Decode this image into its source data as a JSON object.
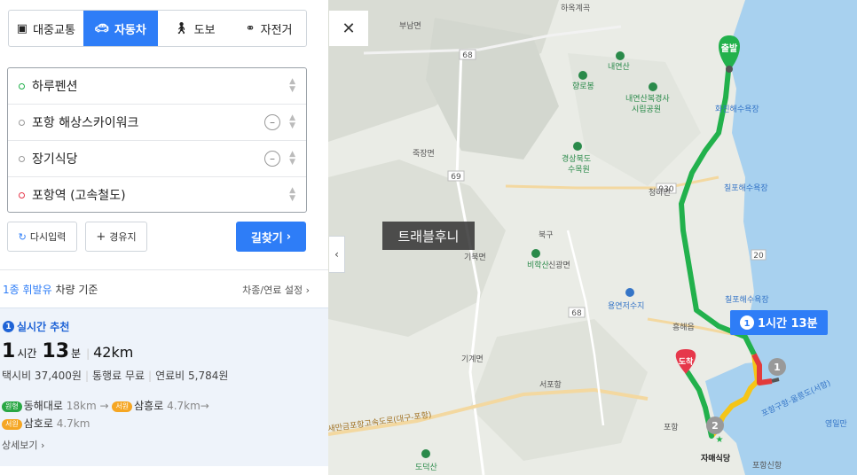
{
  "tabs": [
    {
      "label": "대중교통",
      "icon": "bus-icon"
    },
    {
      "label": "자동차",
      "icon": "car-icon"
    },
    {
      "label": "도보",
      "icon": "walk-icon"
    },
    {
      "label": "자전거",
      "icon": "bike-icon"
    }
  ],
  "waypoints": [
    "하루펜션",
    "포항 해상스카이워크",
    "장기식당",
    "포항역 (고속철도)"
  ],
  "buttons": {
    "reset": "다시입력",
    "add_via": "경유지",
    "find": "길찾기"
  },
  "fuel": {
    "highlight": "1종 휘발유",
    "rest": " 차량 기준",
    "settings": "차종/연료 설정"
  },
  "result": {
    "badge_num": "1",
    "rec_label": "실시간 추천",
    "hour": "1",
    "hour_unit": "시간",
    "minute": "13",
    "minute_unit": "분",
    "distance": "42km",
    "taxi": "택시비 37,400원",
    "toll": "통행료 무료",
    "fuel_cost": "연료비 5,784원",
    "road1_badge": "원형",
    "road1": "동해대로",
    "road1_km": "18km",
    "road2_badge": "서원",
    "road2": "삼흥로",
    "road2_km": "4.7km",
    "road3_badge": "서원",
    "road3": "삼호로",
    "road3_km": "4.7km",
    "arrow": "→",
    "detail": "상세보기"
  },
  "map": {
    "labels": [
      "하옥계곡",
      "부남면",
      "내연산",
      "향로봉",
      "내연산복경사",
      "시립공원",
      "화진해수욕장",
      "죽장면",
      "경상북도",
      "수목원",
      "청하면",
      "칠포해수욕장",
      "기북면",
      "북구",
      "비학산",
      "신광면",
      "용연저수지",
      "칠포해수욕장",
      "흥해읍",
      "기계면",
      "서포항",
      "포항",
      "포항구항-울릉도(서항)",
      "영일만",
      "도덕산",
      "자매식당",
      "포항신항",
      "새만금포항고속도로(대구-포항)"
    ],
    "start_label": "출발",
    "end_label": "도착",
    "route_badge_num": "1",
    "route_badge_text": "1시간 13분",
    "watermark": "트래블후니",
    "road_numbers": [
      "68",
      "69",
      "930",
      "20",
      "68"
    ],
    "marker_nums": [
      "1",
      "2"
    ],
    "colors": {
      "route_green": "#22b14c",
      "route_yellow": "#f5c518",
      "route_red": "#e23b3b",
      "route_badge": "#2e7df7"
    }
  }
}
